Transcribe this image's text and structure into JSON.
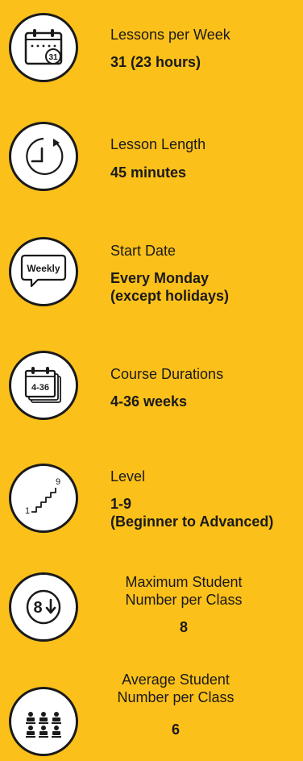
{
  "features": [
    {
      "icon": "calendar-icon",
      "icon_text": "31",
      "label": "Lessons per Week",
      "value_lines": [
        "31 (23 hours)"
      ]
    },
    {
      "icon": "clock-icon",
      "label": "Lesson Length",
      "value_lines": [
        "45 minutes"
      ]
    },
    {
      "icon": "speech-bubble-icon",
      "icon_text": "Weekly",
      "label": "Start Date",
      "value_lines": [
        "Every Monday",
        "(except holidays)"
      ]
    },
    {
      "icon": "stacked-calendar-icon",
      "icon_text": "4-36",
      "label": "Course Durations",
      "value_lines": [
        "4-36 weeks"
      ]
    },
    {
      "icon": "stairs-icon",
      "icon_text_low": "1",
      "icon_text_high": "9",
      "label": "Level",
      "value_lines": [
        "1-9",
        "(Beginner to Advanced)"
      ]
    },
    {
      "icon": "down-arrow-badge-icon",
      "icon_text": "8",
      "label_lines": [
        "Maximum Student",
        "Number per Class"
      ],
      "value_lines": [
        "8"
      ]
    },
    {
      "icon": "students-icon",
      "label_lines": [
        "Average Student",
        "Number per Class"
      ],
      "value_lines": [
        "6"
      ]
    }
  ],
  "colors": {
    "background": "#fcc01a",
    "icon_fill": "#ffffff",
    "ink": "#1a1a1a"
  }
}
